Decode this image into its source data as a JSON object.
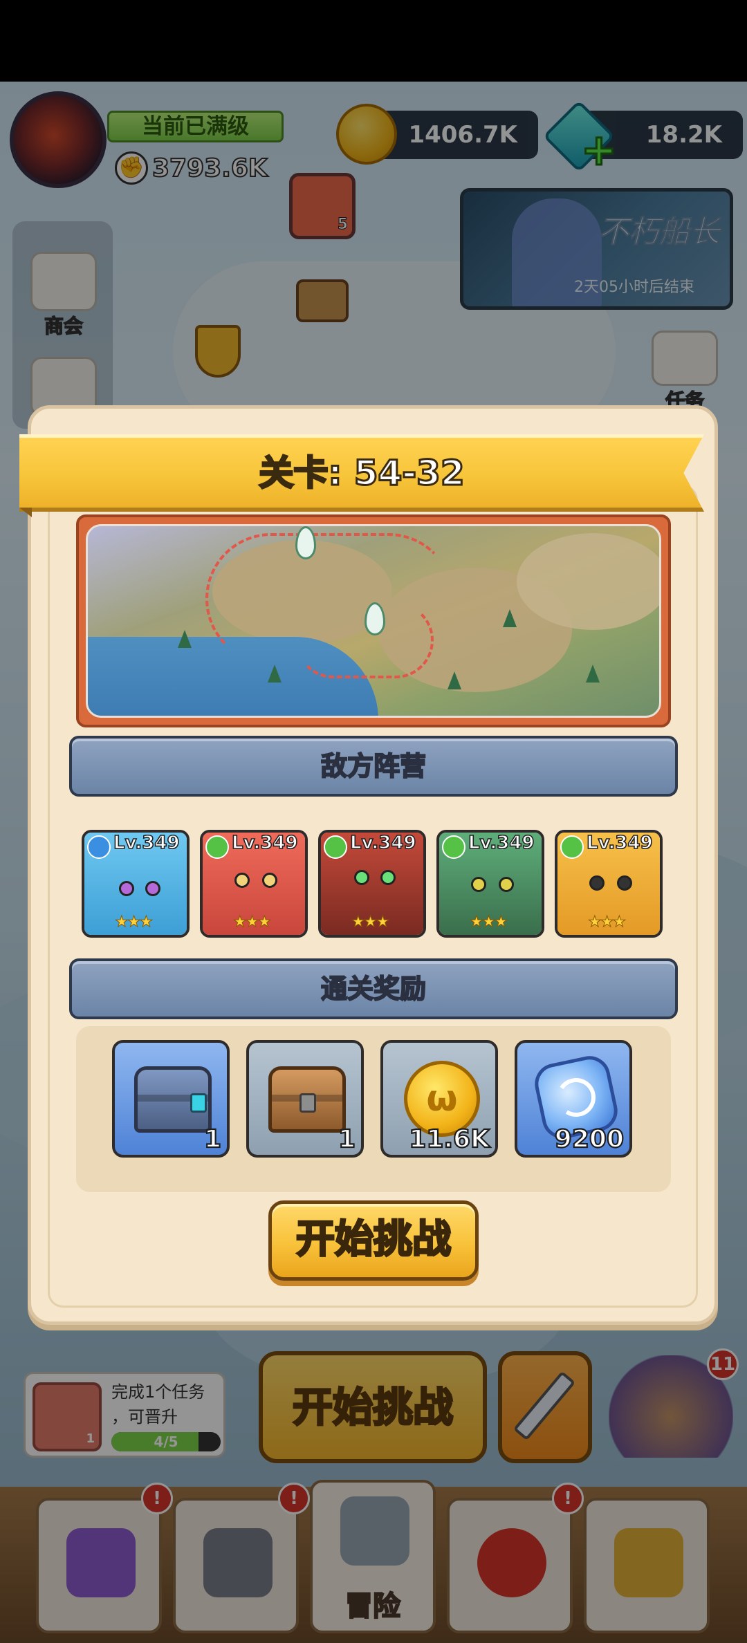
{
  "hud": {
    "level_status": "当前已满级",
    "power_value": "3793.6K",
    "gold_amount": "1406.7K",
    "gem_amount": "18.2K"
  },
  "event": {
    "title": "不朽船长",
    "timer": "2天05小时后结束"
  },
  "side": {
    "shop_label": "商会",
    "task_label": "任务",
    "scroll_count": "5"
  },
  "modal": {
    "title": "关卡: 54-32",
    "enemy_header": "敌方阵营",
    "reward_header": "通关奖励",
    "start_label": "开始挑战",
    "heroes": [
      {
        "level": "Lv.349",
        "element": "water",
        "stars": "★★★"
      },
      {
        "level": "Lv.349",
        "element": "leaf",
        "stars": "★★★"
      },
      {
        "level": "Lv.349",
        "element": "leaf",
        "stars": "★★★"
      },
      {
        "level": "Lv.349",
        "element": "leaf",
        "stars": "★★★"
      },
      {
        "level": "Lv.349",
        "element": "leaf",
        "stars": "★★★"
      }
    ],
    "rewards": [
      {
        "item": "steel-chest-icon",
        "qty": "1"
      },
      {
        "item": "wooden-chest-icon",
        "qty": "1"
      },
      {
        "item": "gold-coin-icon",
        "qty": "11.6K"
      },
      {
        "item": "blue-crystal-icon",
        "qty": "9200"
      }
    ]
  },
  "bottom": {
    "task_text_line1": "完成1个任务",
    "task_text_line2": "，可晋升",
    "task_progress_text": "4/5",
    "task_progress": 0.8,
    "task_icon_count": "1",
    "big_start_label": "开始挑战",
    "reward_badge": "11",
    "nav_alert": "!",
    "nav_adventure_label": "冒险"
  },
  "colors": {
    "ribbon": "#f7c53a",
    "section_bar": "#7a91b2",
    "modal_bg": "#f6e6cc",
    "start_button": "#f8c23a"
  }
}
